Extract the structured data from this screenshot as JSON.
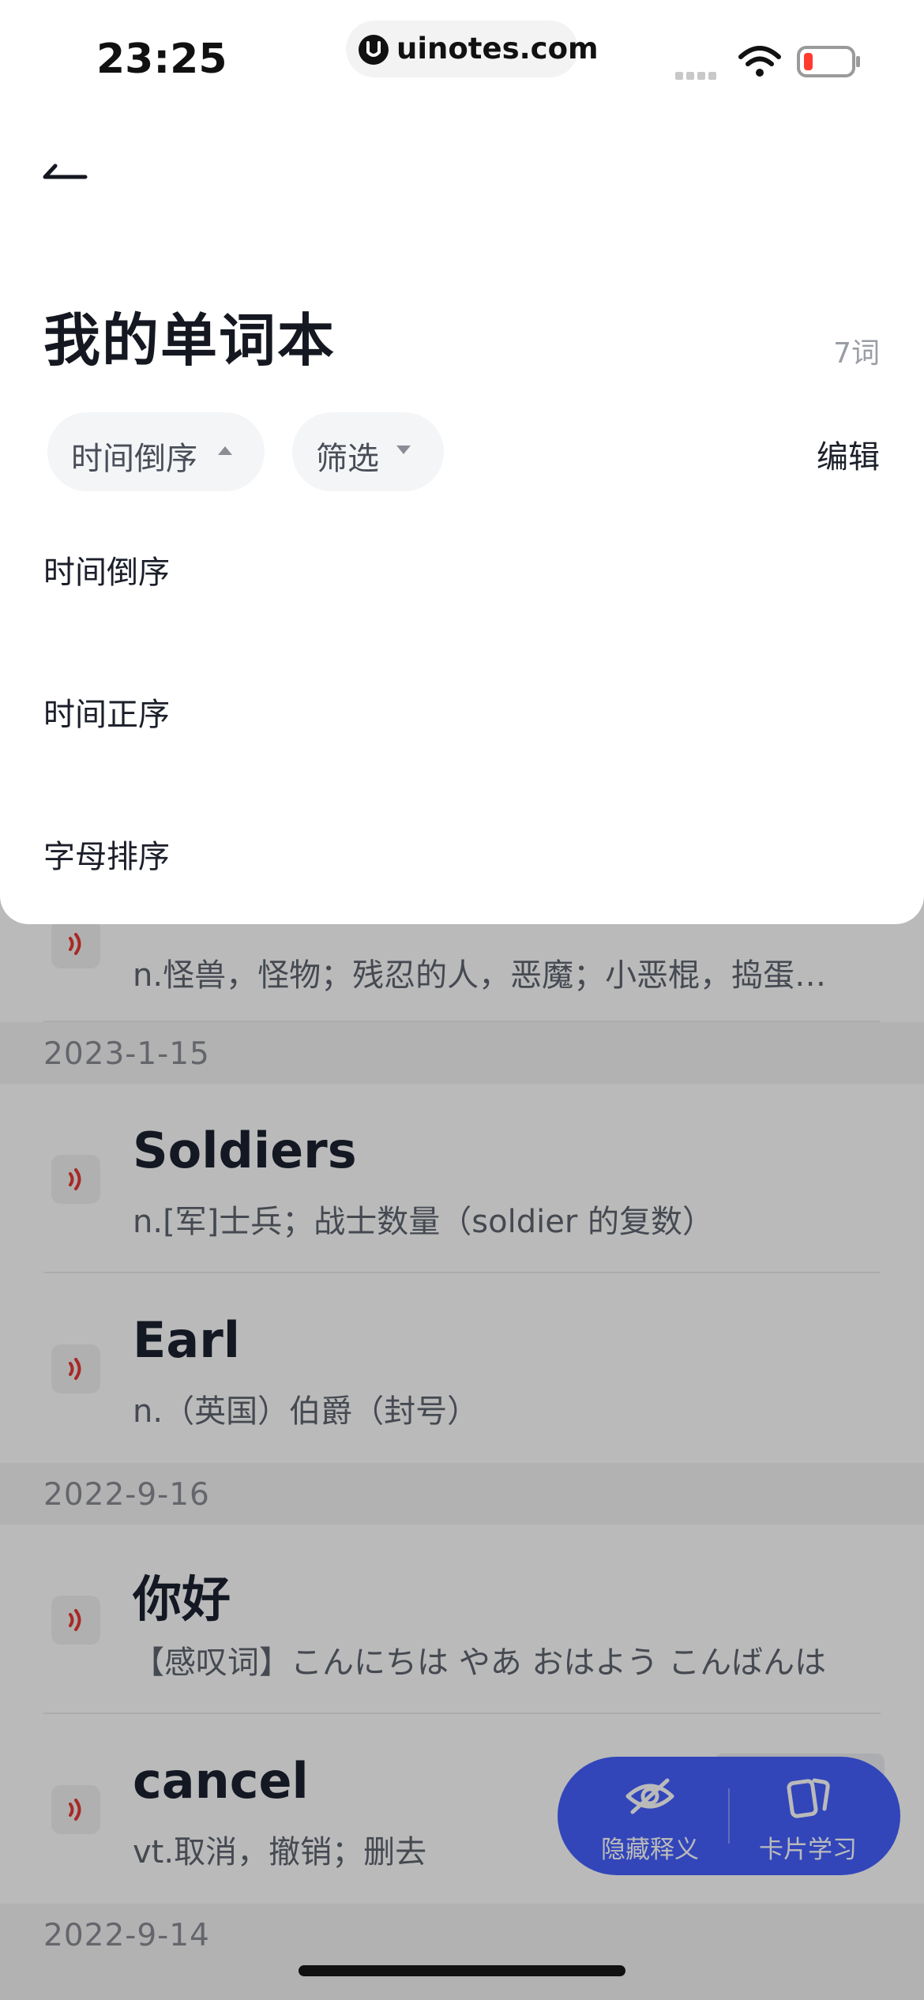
{
  "status_bar": {
    "time": "23:25",
    "url": "uinotes.com"
  },
  "header": {
    "title": "我的单词本",
    "word_count": "7词"
  },
  "toolbar": {
    "sort_chip_label": "时间倒序",
    "filter_chip_label": "筛选",
    "edit_label": "编辑"
  },
  "sort_menu": {
    "options": [
      "时间倒序",
      "时间正序",
      "字母排序"
    ]
  },
  "word_list": {
    "partial_entry_def": "n.怪兽，怪物；残忍的人，恶魔；小恶棍，捣蛋…",
    "groups": [
      {
        "date": "2023-1-15",
        "entries": [
          {
            "word": "Soldiers",
            "definition": "n.[军]士兵；战士数量（soldier 的复数）"
          },
          {
            "word": "Earl",
            "definition": "n.（英国）伯爵（封号）"
          }
        ]
      },
      {
        "date": "2022-9-16",
        "entries": [
          {
            "word": "你好",
            "definition": "【感叹词】こんにちは やあ おはよう こんばんは"
          },
          {
            "word": "cancel",
            "definition": "vt.取消，撤销；删去"
          }
        ]
      },
      {
        "date": "2022-9-14",
        "entries": []
      }
    ]
  },
  "actions": {
    "hide_definitions_label": "隐藏释义",
    "card_study_label": "卡片学习"
  },
  "colors": {
    "accent": "#4560ff",
    "speaker": "#e53935",
    "overlay": "rgba(0,0,0,0.27)"
  }
}
